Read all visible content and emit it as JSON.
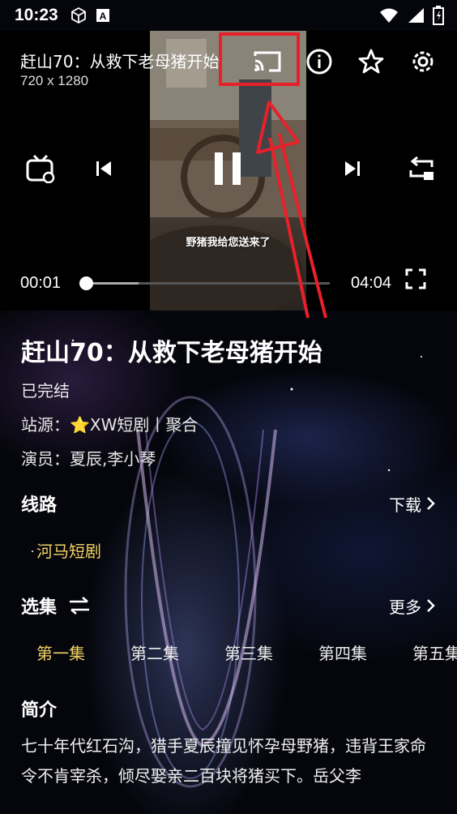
{
  "status_bar": {
    "time": "10:23",
    "icons": [
      "cube-icon",
      "font-app-icon",
      "wifi-icon",
      "signal-icon",
      "battery-icon"
    ]
  },
  "player": {
    "title": "赶山70：从救下老母猪开始",
    "resolution": "720 x 1280",
    "subtitle": "野猪我给您送来了",
    "current_time": "00:01",
    "total_time": "04:04",
    "progress": 0.002,
    "buffered": 0.22,
    "icons": [
      "cast-icon",
      "info-icon",
      "star-icon",
      "settings-icon",
      "tv-icon",
      "skip-previous-icon",
      "pause-icon",
      "skip-next-icon",
      "switch-icon",
      "fullscreen-icon"
    ]
  },
  "detail": {
    "title": "赶山70：从救下老母猪开始",
    "status": "已完结",
    "source": "站源：⭐XW短剧丨聚合",
    "cast": "演员：夏辰,李小琴"
  },
  "routes": {
    "title": "线路",
    "link": "下载",
    "items": [
      "河马短剧"
    ]
  },
  "episodes": {
    "title": "选集",
    "link": "更多",
    "items": [
      "第一集",
      "第二集",
      "第三集",
      "第四集",
      "第五集"
    ]
  },
  "intro": {
    "title": "简介",
    "text": "七十年代红石沟，猎手夏辰撞见怀孕母野猪，违背王家命令不肯宰杀，倾尽娶亲二百块将猪买下。岳父李"
  },
  "colors": {
    "accent": "#f2d264",
    "highlight": "#e8202a"
  }
}
